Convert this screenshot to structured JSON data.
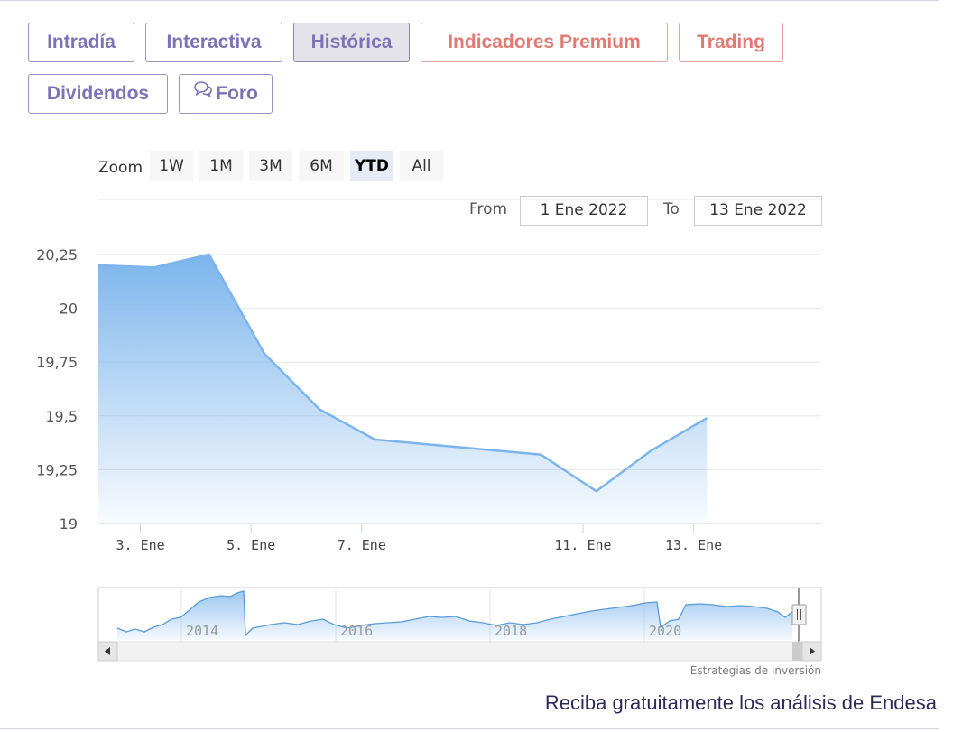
{
  "tabs": [
    {
      "label": "Intradía",
      "state": "normal"
    },
    {
      "label": "Interactiva",
      "state": "normal"
    },
    {
      "label": "Histórica",
      "state": "active"
    },
    {
      "label": "Indicadores Premium",
      "state": "premium"
    },
    {
      "label": "Trading",
      "state": "premium"
    },
    {
      "label": "Dividendos",
      "state": "normal"
    },
    {
      "label": "Foro",
      "state": "normal",
      "icon": "chat-bubbles-icon"
    }
  ],
  "zoom": {
    "label": "Zoom",
    "buttons": [
      "1W",
      "1M",
      "3M",
      "6M",
      "YTD",
      "All"
    ],
    "selected": "YTD"
  },
  "range": {
    "from_label": "From",
    "from_value": "1 Ene 2022",
    "to_label": "To",
    "to_value": "13 Ene 2022"
  },
  "credits": "Estrategias de Inversión",
  "footer_link": "Reciba gratuitamente los análisis de Endesa",
  "colors": {
    "series_line": "#7cb5ec",
    "tab_border": "#9a92c4",
    "premium": "#e07a72"
  },
  "chart_data": {
    "type": "area",
    "x": [
      "2022-01-02",
      "2022-01-03",
      "2022-01-04",
      "2022-01-05",
      "2022-01-06",
      "2022-01-07",
      "2022-01-08",
      "2022-01-09",
      "2022-01-10",
      "2022-01-11",
      "2022-01-12",
      "2022-01-13"
    ],
    "x_ticks": [
      "3. Ene",
      "5. Ene",
      "7. Ene",
      "11. Ene",
      "13. Ene"
    ],
    "series": [
      {
        "values": [
          20.2,
          20.19,
          20.25,
          19.79,
          19.53,
          19.39,
          19.32,
          19.15,
          19.34,
          19.49
        ]
      }
    ],
    "y_ticks": [
      "20,25",
      "20",
      "19,75",
      "19,5",
      "19,25",
      "19"
    ],
    "ylim": [
      19,
      20.25
    ],
    "grid": true,
    "navigator": {
      "x_labels": [
        "2014",
        "2016",
        "2018",
        "2020"
      ]
    }
  }
}
